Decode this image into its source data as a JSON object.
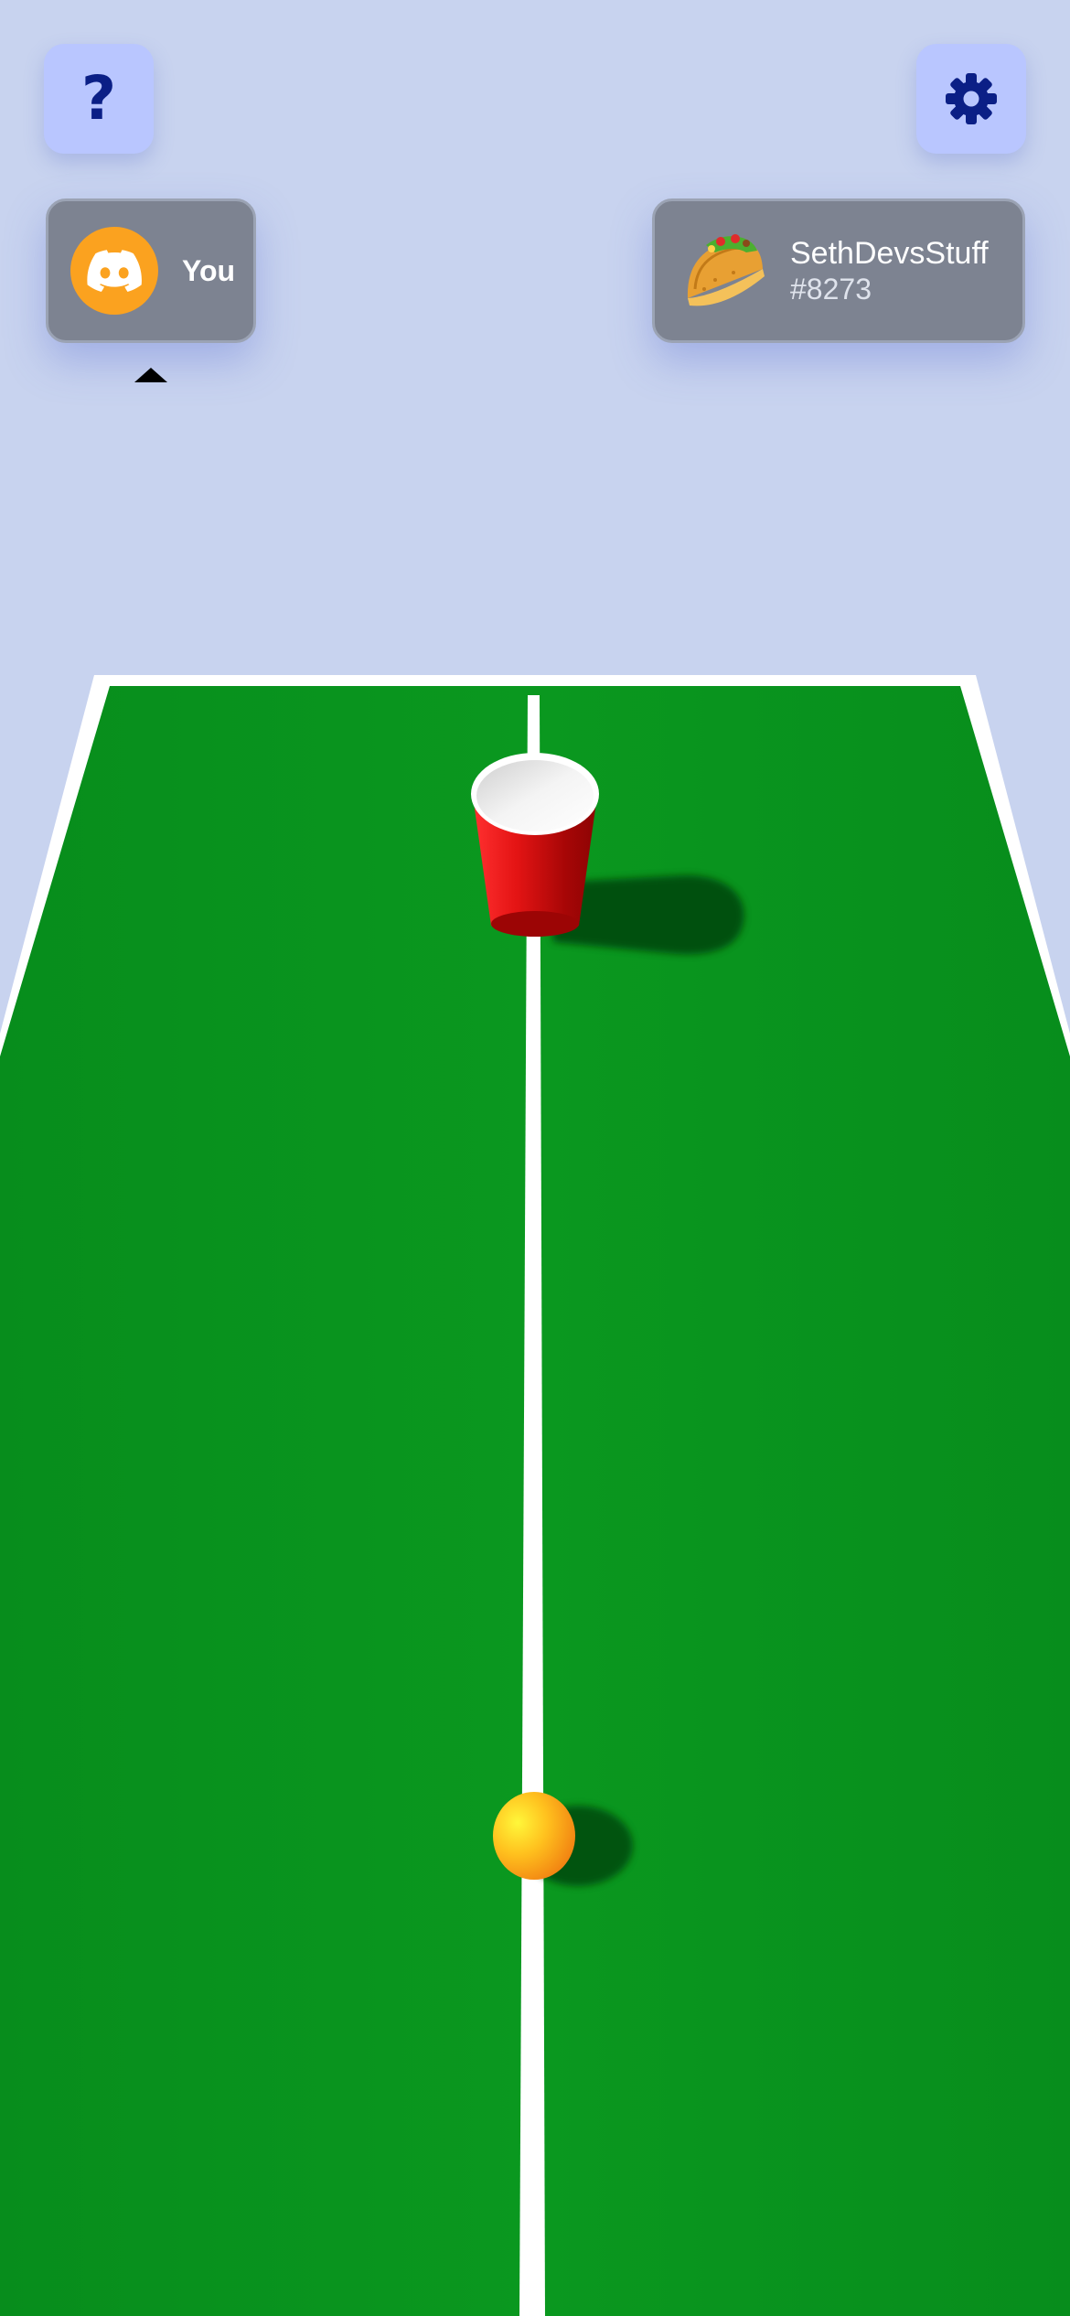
{
  "hud": {
    "help_button": {
      "label": "?",
      "icon": "question-mark-icon"
    },
    "settings_button": {
      "icon": "gear-icon"
    }
  },
  "players": {
    "you": {
      "label": "You",
      "avatar_icon": "discord-logo-icon",
      "avatar_color": "#fba21f",
      "active_turn": true
    },
    "opponent": {
      "name": "SethDevsStuff",
      "tag": "#8273",
      "avatar_icon": "taco-icon"
    }
  },
  "colors": {
    "background": "#c8d3ef",
    "table": "#0a961f",
    "cup": "#e01010",
    "ball": "#ffb319",
    "button": "#b9c6ff",
    "button_icon": "#0b1f86",
    "card": "#7d8391"
  }
}
